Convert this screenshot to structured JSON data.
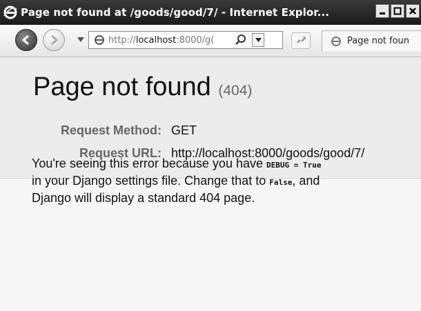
{
  "window": {
    "title": "Page not found at /goods/good/7/ - Internet Explor...",
    "buttons": [
      "minimize",
      "maximize",
      "close"
    ]
  },
  "toolbar": {
    "address_prefix": "http://",
    "address_host": "localhost",
    "address_rest": ":8000/g(",
    "tab_label": "Page not foun"
  },
  "page": {
    "heading": "Page not found",
    "status_code": "(404)",
    "request_method_label": "Request Method:",
    "request_method_value": "GET",
    "request_url_label": "Request URL:",
    "request_url_value": "http://localhost:8000/goods/good/7/",
    "explanation": {
      "line1_text": "You're seeing this error because you have ",
      "line1_code": "DEBUG = True",
      "line2_text": "in your Django settings file. Change that to ",
      "line2_code": "False",
      "line2_tail": ", and",
      "line3_text": "Django will display a standard 404 page."
    }
  },
  "colors": {
    "titlebar": "#1f1f1f",
    "summary_bg": "#ececec",
    "label_gray": "#666666"
  }
}
